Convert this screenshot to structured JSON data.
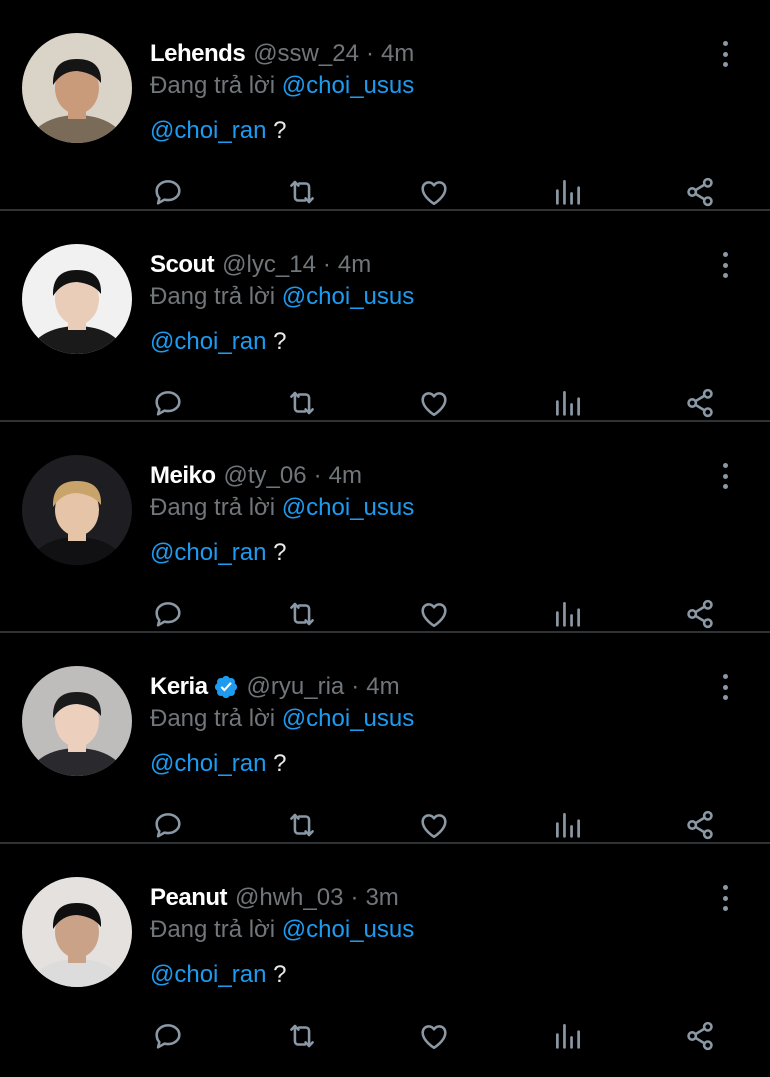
{
  "reply_prefix": "Đang trả lời",
  "tweets": [
    {
      "name": "Lehends",
      "verified": false,
      "handle": "@ssw_24",
      "time": "4m",
      "reply_to": "@choi_usus",
      "mention": "@choi_ran",
      "text": " ?",
      "avatar_colors": {
        "bg": "#d9d3c8",
        "hair": "#151515",
        "skin": "#c99b7b",
        "shirt": "#7a6a58"
      }
    },
    {
      "name": "Scout",
      "verified": false,
      "handle": "@lyc_14",
      "time": "4m",
      "reply_to": "@choi_usus",
      "mention": "@choi_ran",
      "text": " ?",
      "avatar_colors": {
        "bg": "#f1f1f1",
        "hair": "#111111",
        "skin": "#e9cdb8",
        "shirt": "#1a1a1a"
      }
    },
    {
      "name": "Meiko",
      "verified": false,
      "handle": "@ty_06",
      "time": "4m",
      "reply_to": "@choi_usus",
      "mention": "@choi_ran",
      "text": " ?",
      "avatar_colors": {
        "bg": "#1e1e22",
        "hair": "#c8a36a",
        "skin": "#e6c4a8",
        "shirt": "#111114"
      }
    },
    {
      "name": "Keria",
      "verified": true,
      "handle": "@ryu_ria",
      "time": "4m",
      "reply_to": "@choi_usus",
      "mention": "@choi_ran",
      "text": " ?",
      "avatar_colors": {
        "bg": "#bfbcbc",
        "hair": "#1a1a1a",
        "skin": "#ecd0bd",
        "shirt": "#2a2a2e"
      }
    },
    {
      "name": "Peanut",
      "verified": false,
      "handle": "@hwh_03",
      "time": "3m",
      "reply_to": "@choi_usus",
      "mention": "@choi_ran",
      "text": " ?",
      "avatar_colors": {
        "bg": "#e4e1df",
        "hair": "#0f0f0f",
        "skin": "#c9a287",
        "shirt": "#dcdcdc"
      }
    }
  ],
  "colors": {
    "background": "#000000",
    "text": "#e7e9ea",
    "muted": "#71767b",
    "link": "#1d9bf0",
    "divider": "#2f3336",
    "verified": "#1d9bf0"
  },
  "action_icons": [
    "reply-icon",
    "retweet-icon",
    "like-icon",
    "views-icon",
    "share-icon"
  ]
}
